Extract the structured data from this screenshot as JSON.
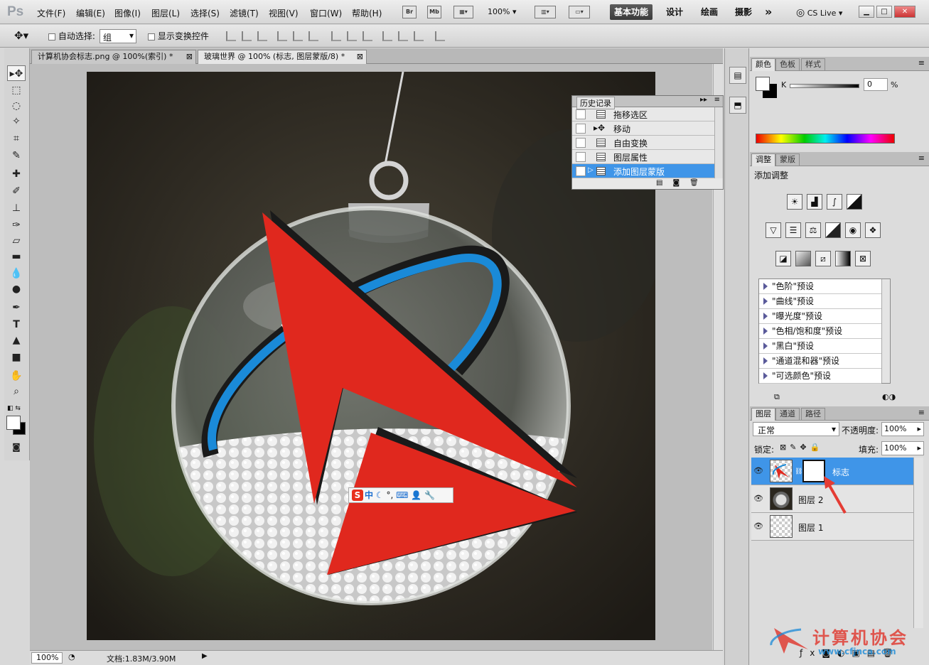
{
  "app": {
    "logo": "Ps"
  },
  "menu": [
    "文件(F)",
    "编辑(E)",
    "图像(I)",
    "图层(L)",
    "选择(S)",
    "滤镜(T)",
    "视图(V)",
    "窗口(W)",
    "帮助(H)"
  ],
  "menubar_icons": [
    "Br",
    "Mb"
  ],
  "zoom": "100%",
  "workspaces": {
    "active": "基本功能",
    "items": [
      "设计",
      "绘画",
      "摄影"
    ],
    "more": "»"
  },
  "cslive": "CS Live",
  "options": {
    "auto_select": "自动选择:",
    "auto_select_value": "组",
    "show_transform": "显示变换控件"
  },
  "tabs": [
    {
      "label": "计算机协会标志.png @ 100%(索引) *"
    },
    {
      "label": "玻璃世界 @ 100% (标志, 图层蒙版/8) *"
    }
  ],
  "history": {
    "title": "历史记录",
    "items": [
      "拖移选区",
      "移动",
      "自由变换",
      "图层属性",
      "添加图层蒙版"
    ]
  },
  "ime_bar": {
    "brand": "S",
    "mode": "中",
    "symbols": "°,"
  },
  "status": {
    "zoom": "100%",
    "doc": "文档:1.83M/3.90M"
  },
  "color_panel": {
    "tabs": [
      "颜色",
      "色板",
      "样式"
    ],
    "channel": "K",
    "value": "0",
    "unit": "%"
  },
  "adjustments": {
    "tabs": [
      "调整",
      "蒙版"
    ],
    "title": "添加调整",
    "presets": [
      "\"色阶\"预设",
      "\"曲线\"预设",
      "\"曝光度\"预设",
      "\"色相/饱和度\"预设",
      "\"黑白\"预设",
      "\"通道混和器\"预设",
      "\"可选颜色\"预设"
    ]
  },
  "layers": {
    "tabs": [
      "图层",
      "通道",
      "路径"
    ],
    "blend_mode": "正常",
    "opacity_label": "不透明度:",
    "opacity": "100%",
    "lock_label": "锁定:",
    "fill_label": "填充:",
    "fill": "100%",
    "items": [
      {
        "name": "标志",
        "selected": true
      },
      {
        "name": "图层 2",
        "selected": false
      },
      {
        "name": "图层 1",
        "selected": false
      }
    ]
  },
  "watermark": {
    "text": "计算机协会",
    "url": "www.cfjnca.com"
  },
  "colors": {
    "selection": "#3f95e8",
    "logo_red": "#e0281e",
    "logo_blue": "#1a8ad8"
  }
}
